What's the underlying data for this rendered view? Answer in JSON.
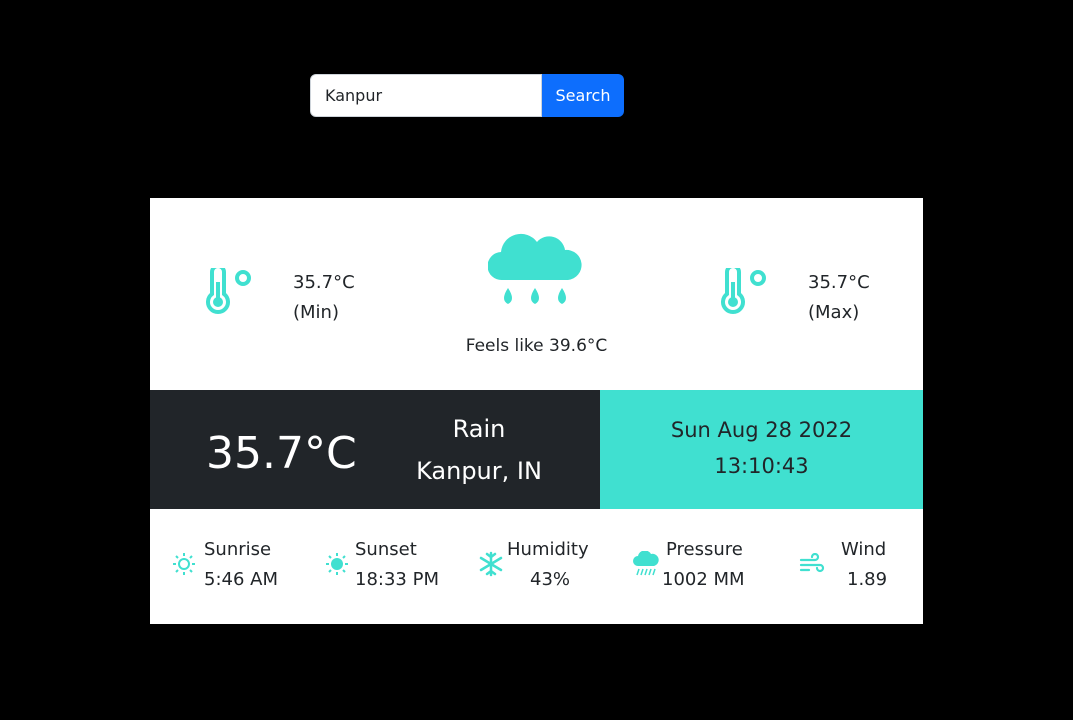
{
  "search": {
    "value": "Kanpur",
    "button_label": "Search"
  },
  "weather": {
    "min_temp": "35.7°C",
    "min_label": "(Min)",
    "max_temp": "35.7°C",
    "max_label": "(Max)",
    "feels_like": "Feels like 39.6°C",
    "current_temp": "35.7°C",
    "condition": "Rain",
    "location": "Kanpur, IN",
    "date": "Sun Aug 28 2022",
    "time": "13:10:43"
  },
  "stats": {
    "sunrise": {
      "label": "Sunrise",
      "value": "5:46 AM",
      "icon": "sunrise-icon"
    },
    "sunset": {
      "label": "Sunset",
      "value": "18:33 PM",
      "icon": "sunset-icon"
    },
    "humidity": {
      "label": "Humidity",
      "value": "43%",
      "icon": "snowflake-icon"
    },
    "pressure": {
      "label": "Pressure",
      "value": "1002 MM",
      "icon": "rain-cloud-icon"
    },
    "wind": {
      "label": "Wind",
      "value": "1.89",
      "icon": "wind-icon"
    }
  },
  "colors": {
    "accent": "#40e0d0",
    "dark": "#212529",
    "primary": "#0d6efd"
  }
}
